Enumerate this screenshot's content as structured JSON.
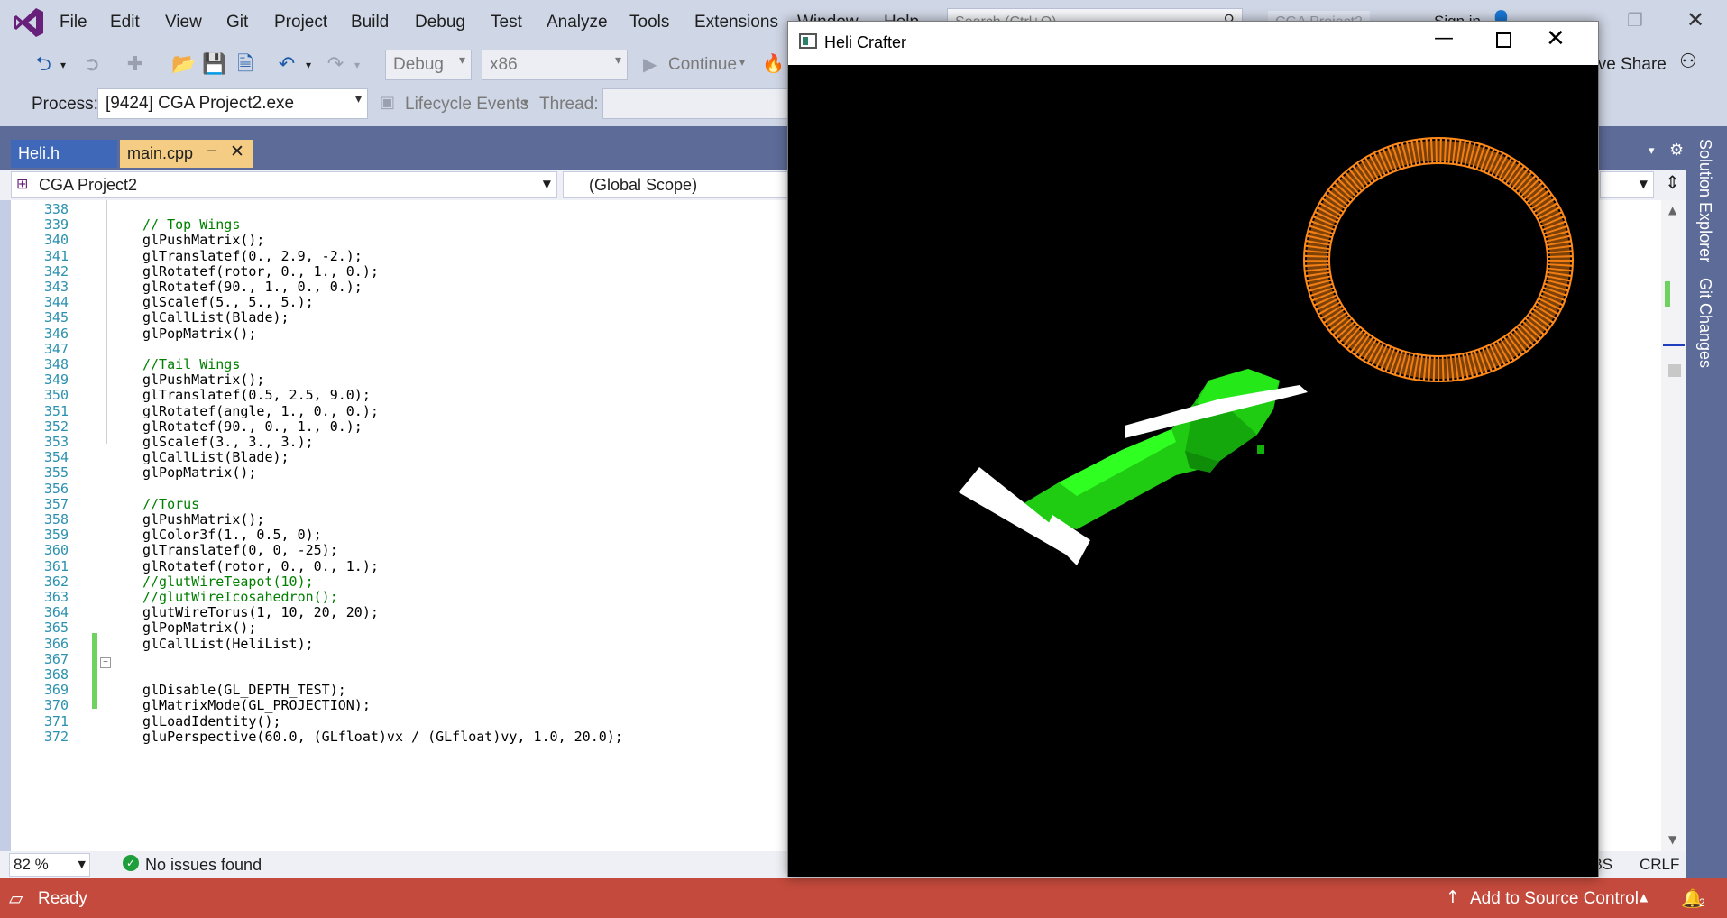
{
  "menu": {
    "items": [
      "File",
      "Edit",
      "View",
      "Git",
      "Project",
      "Build",
      "Debug",
      "Test",
      "Analyze",
      "Tools",
      "Extensions",
      "Window",
      "Help"
    ],
    "search_placeholder": "Search (Ctrl+Q)",
    "solution_name": "CGA Project2",
    "sign_in": "Sign in"
  },
  "toolbar": {
    "config": "Debug",
    "platform": "x86",
    "continue_label": "Continue",
    "live_share": "Live Share"
  },
  "debug_location": {
    "process_label": "Process:",
    "process_value": "[9424] CGA Project2.exe",
    "lifecycle_label": "Lifecycle Events",
    "thread_label": "Thread:"
  },
  "tabs": [
    {
      "label": "Heli.h",
      "active": false
    },
    {
      "label": "main.cpp",
      "active": true
    }
  ],
  "navbar": {
    "project": "CGA Project2",
    "scope": "(Global Scope)"
  },
  "editor": {
    "lines": [
      {
        "n": "338",
        "t": ""
      },
      {
        "n": "339",
        "t": "// Top Wings",
        "c": "cm"
      },
      {
        "n": "340",
        "t": "glPushMatrix();"
      },
      {
        "n": "341",
        "t": "glTranslatef(0., 2.9, -2.);"
      },
      {
        "n": "342",
        "t": "glRotatef(rotor, 0., 1., 0.);"
      },
      {
        "n": "343",
        "t": "glRotatef(90., 1., 0., 0.);"
      },
      {
        "n": "344",
        "t": "glScalef(5., 5., 5.);"
      },
      {
        "n": "345",
        "t": "glCallList(Blade);"
      },
      {
        "n": "346",
        "t": "glPopMatrix();"
      },
      {
        "n": "347",
        "t": ""
      },
      {
        "n": "348",
        "t": "//Tail Wings",
        "c": "cm"
      },
      {
        "n": "349",
        "t": "glPushMatrix();"
      },
      {
        "n": "350",
        "t": "glTranslatef(0.5, 2.5, 9.0);"
      },
      {
        "n": "351",
        "t": "glRotatef(angle, 1., 0., 0.);"
      },
      {
        "n": "352",
        "t": "glRotatef(90., 0., 1., 0.);"
      },
      {
        "n": "353",
        "t": "glScalef(3., 3., 3.);"
      },
      {
        "n": "354",
        "t": "glCallList(Blade);"
      },
      {
        "n": "355",
        "t": "glPopMatrix();"
      },
      {
        "n": "356",
        "t": ""
      },
      {
        "n": "357",
        "t": "//Torus",
        "c": "cm"
      },
      {
        "n": "358",
        "t": "glPushMatrix();"
      },
      {
        "n": "359",
        "t": "glColor3f(1., 0.5, 0);"
      },
      {
        "n": "360",
        "t": "glTranslatef(0, 0, -25);"
      },
      {
        "n": "361",
        "t": "glRotatef(rotor, 0., 0., 1.);"
      },
      {
        "n": "362",
        "t": "//glutWireTeapot(10);",
        "c": "cm"
      },
      {
        "n": "363",
        "t": "//glutWireIcosahedron();",
        "c": "cm"
      },
      {
        "n": "364",
        "t": "glutWireTorus(1, 10, 20, 20);"
      },
      {
        "n": "365",
        "t": "glPopMatrix();"
      },
      {
        "n": "366",
        "t": "glCallList(HeliList);"
      },
      {
        "n": "367",
        "t": ""
      },
      {
        "n": "368",
        "t": ""
      },
      {
        "n": "369",
        "t": "glDisable(GL_DEPTH_TEST);"
      },
      {
        "n": "370",
        "t": "glMatrixMode(GL_PROJECTION);"
      },
      {
        "n": "371",
        "t": "glLoadIdentity();"
      },
      {
        "n": "372",
        "t": "gluPerspective(60.0, (GLfloat)vx / (GLfloat)vy, 1.0, 20.0);"
      }
    ]
  },
  "editor_status": {
    "zoom": "82 %",
    "issues": "No issues found",
    "tabs_mode": "TABS",
    "line_ending": "CRLF"
  },
  "statusbar": {
    "ready": "Ready",
    "source_control": "Add to Source Control",
    "notifications": "2"
  },
  "side_panel": {
    "solution_explorer": "Solution Explorer",
    "git_changes": "Git Changes"
  },
  "heli_window": {
    "title": "Heli Crafter"
  },
  "colors": {
    "accent": "#5d6b99",
    "status_bar": "#c34a3c",
    "torus": "#ff8a1a",
    "heli_body": "#1fcc12",
    "active_tab": "#f5cc84"
  }
}
